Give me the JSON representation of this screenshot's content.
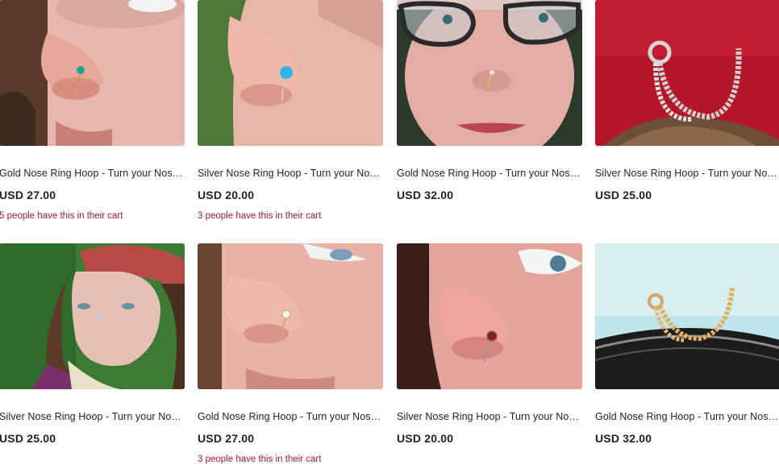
{
  "colors": {
    "text": "#222222",
    "cart_note": "#a61a2e"
  },
  "listings": [
    {
      "title": "Gold Nose Ring Hoop - Turn your Nose ...",
      "price": "USD 27.00",
      "cart_note": "5 people have this in their cart",
      "image": "nose-ring-photo"
    },
    {
      "title": "Silver Nose Ring Hoop - Turn your Nose...",
      "price": "USD 20.00",
      "cart_note": "3 people have this in their cart",
      "image": "nose-ring-photo"
    },
    {
      "title": "Gold Nose Ring Hoop - Turn your Nose ...",
      "price": "USD 32.00",
      "cart_note": "",
      "image": "nose-ring-photo"
    },
    {
      "title": "Silver Nose Ring Hoop - Turn your Nose...",
      "price": "USD 25.00",
      "cart_note": "",
      "image": "nose-cuff-product-photo"
    },
    {
      "title": "Silver Nose Ring Hoop - Turn your Nose...",
      "price": "USD 25.00",
      "cart_note": "",
      "image": "nose-ring-photo"
    },
    {
      "title": "Gold Nose Ring Hoop - Turn your Nose ...",
      "price": "USD 27.00",
      "cart_note": "3 people have this in their cart",
      "image": "nose-ring-photo"
    },
    {
      "title": "Silver Nose Ring Hoop - Turn your Nose...",
      "price": "USD 20.00",
      "cart_note": "",
      "image": "nose-ring-photo"
    },
    {
      "title": "Gold Nose Ring Hoop - Turn your Nose ...",
      "price": "USD 32.00",
      "cart_note": "",
      "image": "nose-cuff-product-photo"
    }
  ]
}
